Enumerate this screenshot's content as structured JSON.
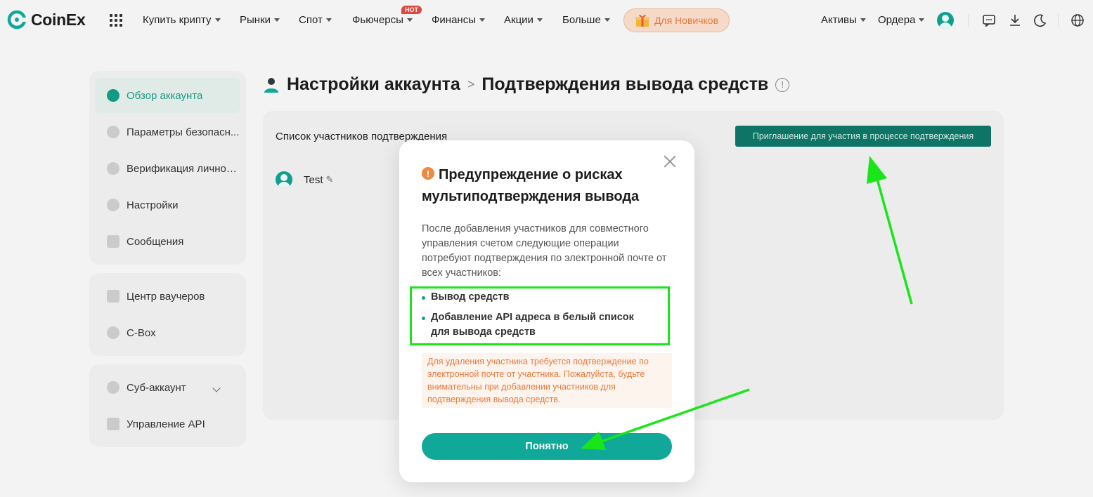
{
  "brand": {
    "name": "CoinEx",
    "accent": "#10a898"
  },
  "nav": {
    "items": [
      {
        "label": "Купить крипту"
      },
      {
        "label": "Рынки"
      },
      {
        "label": "Спот"
      },
      {
        "label": "Фьючерсы",
        "badge": "HOT"
      },
      {
        "label": "Финансы"
      },
      {
        "label": "Акции"
      },
      {
        "label": "Больше"
      }
    ],
    "newbie_label": "Для Новичков",
    "right": {
      "assets_label": "Активы",
      "orders_label": "Ордера"
    },
    "icons": [
      "apps-grid-icon",
      "avatar",
      "chat-icon",
      "download-icon",
      "moon-icon",
      "globe-icon"
    ]
  },
  "sidebar": {
    "group1": [
      {
        "label": "Обзор аккаунта",
        "active": true,
        "icon": "pie-chart-icon"
      },
      {
        "label": "Параметры безопасн...",
        "icon": "shield-icon"
      },
      {
        "label": "Верификация личности",
        "icon": "id-icon"
      },
      {
        "label": "Настройки",
        "icon": "gear-icon"
      },
      {
        "label": "Сообщения",
        "icon": "message-icon"
      }
    ],
    "group2": [
      {
        "label": "Центр ваучеров",
        "icon": "voucher-icon"
      },
      {
        "label": "C-Box",
        "icon": "box-icon"
      }
    ],
    "group3": [
      {
        "label": "Суб-аккаунт",
        "icon": "sub-account-icon"
      },
      {
        "label": "Управление API",
        "icon": "api-icon"
      }
    ]
  },
  "breadcrumb": {
    "root": "Настройки аккаунта",
    "separator": ">",
    "current": "Подтверждения вывода средств",
    "info_glyph": "!"
  },
  "main": {
    "list_title": "Список участников подтверждения",
    "invite_button": "Приглашение для участия в процессе подтверждения",
    "members": [
      {
        "name": "Test"
      }
    ]
  },
  "modal": {
    "title": "Предупреждение о рисках мультиподтверждения вывода",
    "warning_glyph": "!",
    "description": "После добавления участников для совместного управления счетом следующие операции потребуют подтверждения по электронной почте от всех участников:",
    "bullets": [
      "Вывод средств",
      "Добавление API адреса в белый список для вывода средств"
    ],
    "notice": "Для удаления участника требуется подтверждение по электронной почте от участника. Пожалуйста, будьте внимательны при добавлении участников для подтверждения вывода средств.",
    "ok_button": "Понятно"
  },
  "annotation": {
    "color": "#19e619"
  }
}
